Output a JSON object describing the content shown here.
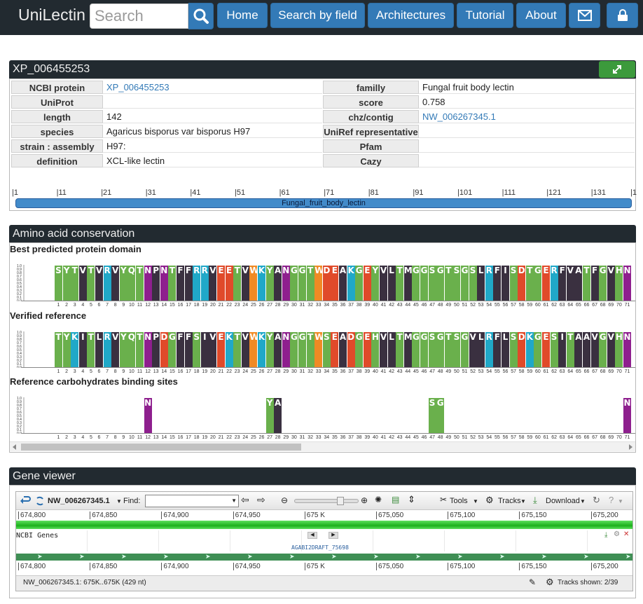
{
  "nav": {
    "brand": "UniLectin",
    "search_placeholder": "Search",
    "buttons": [
      "Home",
      "Search by field",
      "Architectures",
      "Tutorial",
      "About"
    ]
  },
  "protein_panel": {
    "title": "XP_006455253",
    "left_rows": [
      {
        "label": "NCBI protein",
        "value": "XP_006455253",
        "link": true
      },
      {
        "label": "UniProt",
        "value": "",
        "link": false
      },
      {
        "label": "length",
        "value": "142",
        "link": false
      },
      {
        "label": "species",
        "value": "Agaricus bisporus var bisporus H97",
        "link": false
      },
      {
        "label": "strain : assembly",
        "value": "H97:",
        "link": false
      },
      {
        "label": "definition",
        "value": "XCL-like lectin",
        "link": false
      }
    ],
    "right_rows": [
      {
        "label": "familly",
        "value": "Fungal fruit body lectin",
        "link": false
      },
      {
        "label": "score",
        "value": "0.758",
        "link": false
      },
      {
        "label": "chz/contig",
        "value": "NW_006267345.1",
        "link": true
      },
      {
        "label": "UniRef representative",
        "value": "",
        "link": false
      },
      {
        "label": "Pfam",
        "value": "",
        "link": false
      },
      {
        "label": "Cazy",
        "value": "",
        "link": false
      }
    ],
    "ruler_ticks": [
      "1",
      "11",
      "21",
      "31",
      "41",
      "51",
      "61",
      "71",
      "81",
      "91",
      "101",
      "111",
      "121",
      "131",
      "1"
    ],
    "domain_label": "Fungal_fruit_body_lectin"
  },
  "conservation": {
    "title": "Amino acid conservation",
    "y_ticks": [
      "1.0",
      "0.9",
      "0.8",
      "0.7",
      "0.6",
      "0.5",
      "0.4",
      "0.3",
      "0.2",
      "0.1",
      "0.0"
    ],
    "positions": [
      "1",
      "2",
      "3",
      "4",
      "5",
      "6",
      "7",
      "8",
      "9",
      "10",
      "11",
      "12",
      "13",
      "14",
      "15",
      "16",
      "17",
      "18",
      "19",
      "20",
      "21",
      "22",
      "23",
      "24",
      "25",
      "26",
      "27",
      "28",
      "29",
      "30",
      "31",
      "32",
      "33",
      "34",
      "35",
      "36",
      "37",
      "38",
      "39",
      "40",
      "41",
      "42",
      "43",
      "44",
      "45",
      "46",
      "47",
      "48",
      "49",
      "50",
      "51",
      "52",
      "53",
      "54",
      "55",
      "56",
      "57",
      "58",
      "59",
      "60",
      "61",
      "62",
      "63",
      "64",
      "65",
      "66",
      "67",
      "68",
      "69",
      "70",
      "71"
    ],
    "sections": [
      {
        "title": "Best predicted protein domain",
        "sequence": "SYTVTVRVYQTNPNTFFRRVEETVWKYANGGTWDEAKGEYVLTMGGSGTSGSLRFISDTGERFVATFGVHN"
      },
      {
        "title": "Verified reference",
        "sequence": "TYKITLRVYQTNPDGFFSIVEKTVWKYANGGTWSEADGEHVLTMGGSGTSGVLRFLSDKGESITAAVGVHN"
      },
      {
        "title": "Reference carbohydrates binding sites",
        "sequence": "           N              YA                  SG                      N"
      }
    ],
    "residue_colors": {
      "G": "#6ab04c",
      "S": "#6ab04c",
      "T": "#6ab04c",
      "Y": "#6ab04c",
      "Q": "#6ab04c",
      "C": "#6ab04c",
      "H": "#6ab04c",
      "A": "#3a3040",
      "V": "#3a3040",
      "L": "#3a3040",
      "I": "#3a3040",
      "P": "#3a3040",
      "F": "#3a3040",
      "M": "#3a3040",
      "N": "#8e1f8e",
      "D": "#e04a2a",
      "E": "#e04a2a",
      "K": "#20a8c8",
      "R": "#20a8c8",
      "W": "#f08a24"
    }
  },
  "gene_viewer": {
    "title": "Gene viewer",
    "contig": "NW_006267345.1",
    "find_label": "Find:",
    "find_value": "",
    "menu_tools": "Tools",
    "menu_tracks": "Tracks",
    "menu_download": "Download",
    "ticks": [
      "674,800",
      "674,850",
      "674,900",
      "674,950",
      "675 K",
      "675,050",
      "675,100",
      "675,150",
      "675,200"
    ],
    "track_label": "NCBI Genes",
    "gene_name": "AGABI2DRAFT_75698",
    "status_left": "NW_006267345.1: 675K..675K (429 nt)",
    "status_right": "Tracks shown: 2/39"
  }
}
